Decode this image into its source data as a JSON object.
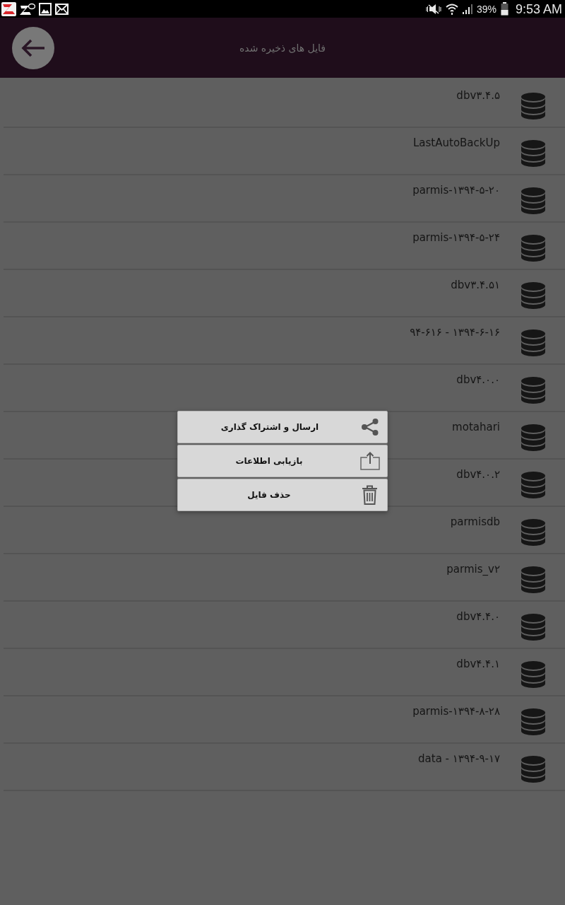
{
  "status_bar": {
    "battery": "39%",
    "time": "9:53 AM"
  },
  "header": {
    "title": "فایل های ذخیره شده"
  },
  "files": [
    {
      "name": "dbv۳.۴.۵"
    },
    {
      "name": "LastAutoBackUp"
    },
    {
      "name": "parmis-۱۳۹۴-۵-۲۰"
    },
    {
      "name": "parmis-۱۳۹۴-۵-۲۴"
    },
    {
      "name": "dbv۳.۴.۵۱"
    },
    {
      "name": "۹۴-۶۱۶ - ۱۳۹۴-۶-۱۶"
    },
    {
      "name": "dbv۴.۰.۰"
    },
    {
      "name": "motahari"
    },
    {
      "name": "dbv۴.۰.۲"
    },
    {
      "name": "parmisdb"
    },
    {
      "name": "parmis_v۲"
    },
    {
      "name": "dbv۴.۴.۰"
    },
    {
      "name": "dbv۴.۴.۱"
    },
    {
      "name": "parmis-۱۳۹۴-۸-۲۸"
    },
    {
      "name": "data - ۱۳۹۴-۹-۱۷"
    }
  ],
  "context_menu": {
    "items": [
      {
        "label": "ارسال و اشتراک گذاری",
        "kind": "share"
      },
      {
        "label": "بازیابی اطلاعات",
        "kind": "export"
      },
      {
        "label": "حذف فایل",
        "kind": "delete"
      }
    ]
  }
}
